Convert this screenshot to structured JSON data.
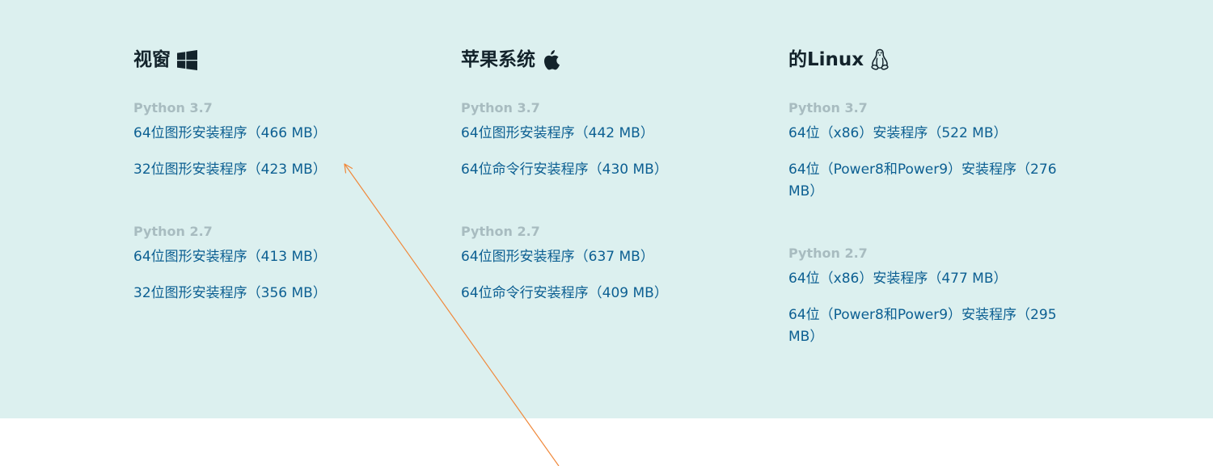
{
  "columns": [
    {
      "heading": "视窗",
      "icon": "windows-icon",
      "groups": [
        {
          "version": "Python 3.7",
          "installers": [
            "64位图形安装程序（466 MB）",
            "32位图形安装程序（423 MB）"
          ]
        },
        {
          "version": "Python 2.7",
          "installers": [
            "64位图形安装程序（413 MB）",
            "32位图形安装程序（356 MB）"
          ]
        }
      ]
    },
    {
      "heading": "苹果系统",
      "icon": "apple-icon",
      "groups": [
        {
          "version": "Python 3.7",
          "installers": [
            "64位图形安装程序（442 MB）",
            "64位命令行安装程序（430 MB）"
          ]
        },
        {
          "version": "Python 2.7",
          "installers": [
            "64位图形安装程序（637 MB）",
            "64位命令行安装程序（409 MB）"
          ]
        }
      ]
    },
    {
      "heading": "的Linux",
      "icon": "linux-penguin-icon",
      "groups": [
        {
          "version": "Python 3.7",
          "installers": [
            "64位（x86）安装程序（522 MB）",
            "64位（Power8和Power9）安装程序（276 MB）"
          ]
        },
        {
          "version": "Python 2.7",
          "installers": [
            "64位（x86）安装程序（477 MB）",
            "64位（Power8和Power9）安装程序（295 MB）"
          ]
        }
      ]
    }
  ],
  "colors": {
    "panel_background": "#dcf0ef",
    "heading_text": "#13232b",
    "version_text": "#a8bcc0",
    "link_text": "#0c5f92",
    "annotation_arrow": "#f0883a"
  }
}
